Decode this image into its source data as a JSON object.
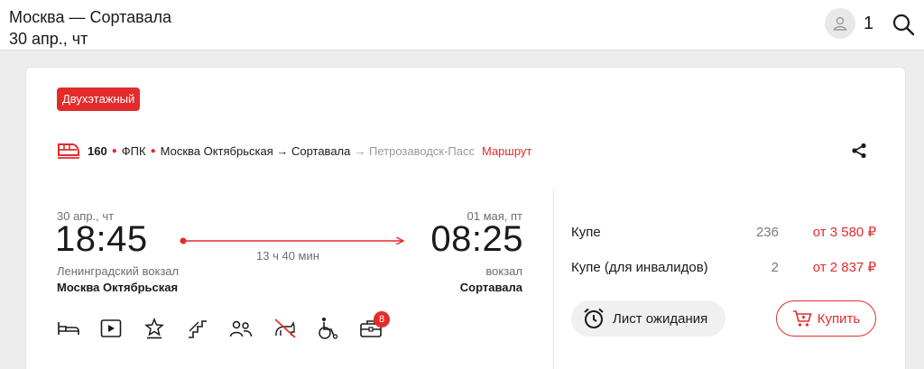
{
  "header": {
    "route": "Москва — Сортавала",
    "date": "30 апр., чт",
    "passengers": "1"
  },
  "train": {
    "badge": "Двухэтажный",
    "number": "160",
    "carrier": "ФПК",
    "route": "Москва Октябрьская → Сортавала",
    "via": "→ Петрозаводск-Пасс",
    "route_link": "Маршрут"
  },
  "trip": {
    "departure_date": "30 апр., чт",
    "departure_time": "18:45",
    "departure_station_sub": "Ленинградский вокзал",
    "departure_station": "Москва Октябрьская",
    "duration": "13 ч 40 мин",
    "arrival_date": "01 мая, пт",
    "arrival_time": "08:25",
    "arrival_station_sub": "вокзал",
    "arrival_station": "Сортавала"
  },
  "amenities": [
    "bed-icon",
    "media-icon",
    "award-icon",
    "stairs-icon",
    "passengers-icon",
    "no-pets-icon",
    "wheelchair-icon",
    "luggage-icon"
  ],
  "luggage_badge": "8",
  "classes": [
    {
      "name": "Купе",
      "seats": "236",
      "price": "от 3 580 ₽"
    },
    {
      "name": "Купе (для инвалидов)",
      "seats": "2",
      "price": "от 2 837 ₽"
    }
  ],
  "actions": {
    "waitlist_label": "Лист ожидания",
    "buy_label": "Купить"
  },
  "colors": {
    "accent": "#e32b2b",
    "muted": "#6e6e6e"
  }
}
